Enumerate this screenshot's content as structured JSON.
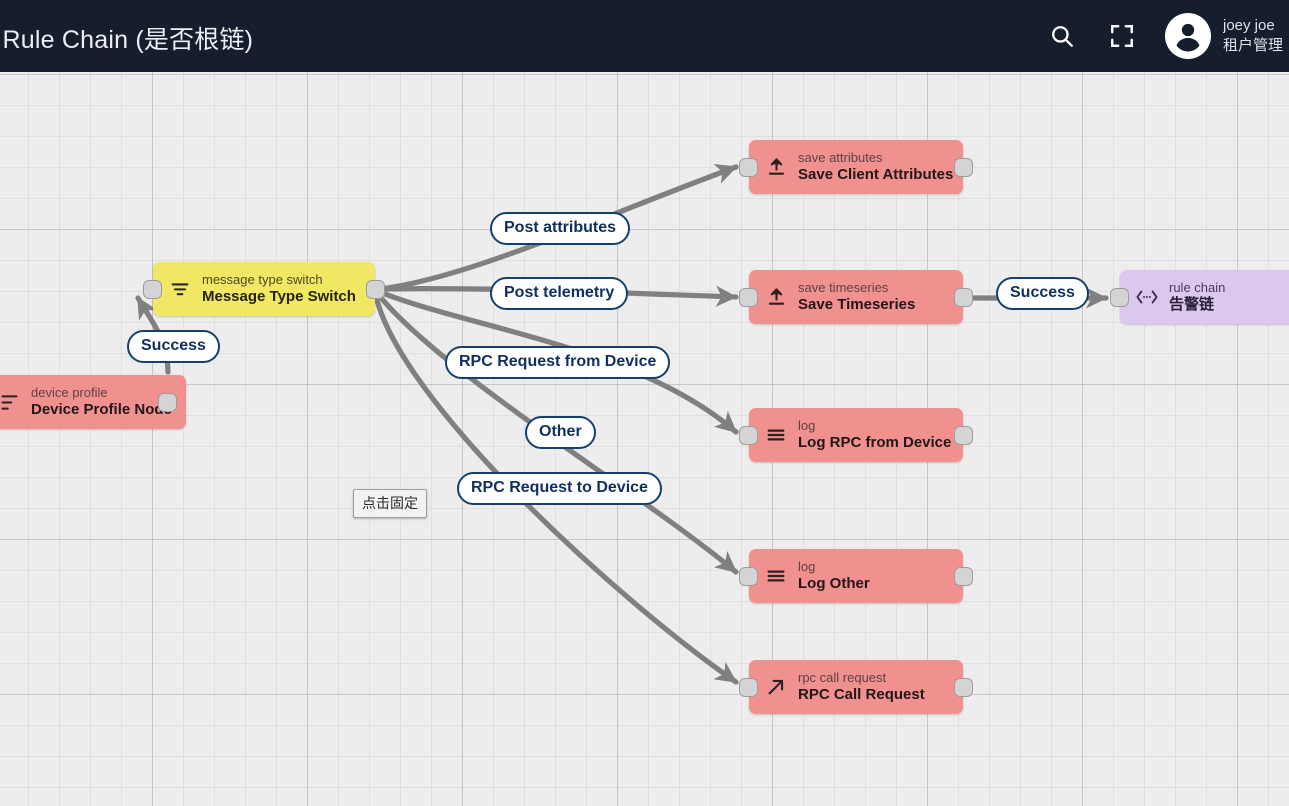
{
  "topbar": {
    "title": "oot Rule Chain (是否根链)",
    "search_icon": "search-icon",
    "fullscreen_icon": "fullscreen-icon",
    "avatar_icon": "user-avatar-icon",
    "user_name": "joey joe",
    "user_role": "租户管理"
  },
  "tooltip": {
    "text": "点击固定"
  },
  "colors": {
    "topbar_bg": "#161d2d",
    "canvas_bg": "#ededed",
    "node_red": "#f1918f",
    "node_yellow": "#f0e763",
    "node_purple": "#dcc8ee",
    "edge_stroke": "#808080",
    "label_border": "#15406e",
    "label_text": "#0f2f5e"
  },
  "nodes": [
    {
      "id": "device-profile",
      "type": "device profile",
      "title": "Device Profile Node",
      "icon": "device-profile-icon",
      "color": "red"
    },
    {
      "id": "message-type-switch",
      "type": "message type switch",
      "title": "Message Type Switch",
      "icon": "filter-icon",
      "color": "yellow"
    },
    {
      "id": "save-client-attributes",
      "type": "save attributes",
      "title": "Save Client Attributes",
      "icon": "upload-icon",
      "color": "red"
    },
    {
      "id": "save-timeseries",
      "type": "save timeseries",
      "title": "Save Timeseries",
      "icon": "upload-icon",
      "color": "red"
    },
    {
      "id": "log-rpc-from-device",
      "type": "log",
      "title": "Log RPC from Device",
      "icon": "lines-icon",
      "color": "red"
    },
    {
      "id": "log-other",
      "type": "log",
      "title": "Log Other",
      "icon": "lines-icon",
      "color": "red"
    },
    {
      "id": "rpc-call-request",
      "type": "rpc call request",
      "title": "RPC Call Request",
      "icon": "arrow-up-right-icon",
      "color": "red"
    },
    {
      "id": "rule-chain-alarm",
      "type": "rule chain",
      "title": "告警链",
      "icon": "rule-chain-icon",
      "color": "purple"
    }
  ],
  "edge_labels": [
    {
      "id": "success-device-profile",
      "text": "Success"
    },
    {
      "id": "post-attributes",
      "text": "Post attributes"
    },
    {
      "id": "post-telemetry",
      "text": "Post telemetry"
    },
    {
      "id": "rpc-request-from-device",
      "text": "RPC Request from Device"
    },
    {
      "id": "other",
      "text": "Other"
    },
    {
      "id": "rpc-request-to-device",
      "text": "RPC Request to Device"
    },
    {
      "id": "success-timeseries",
      "text": "Success"
    }
  ]
}
